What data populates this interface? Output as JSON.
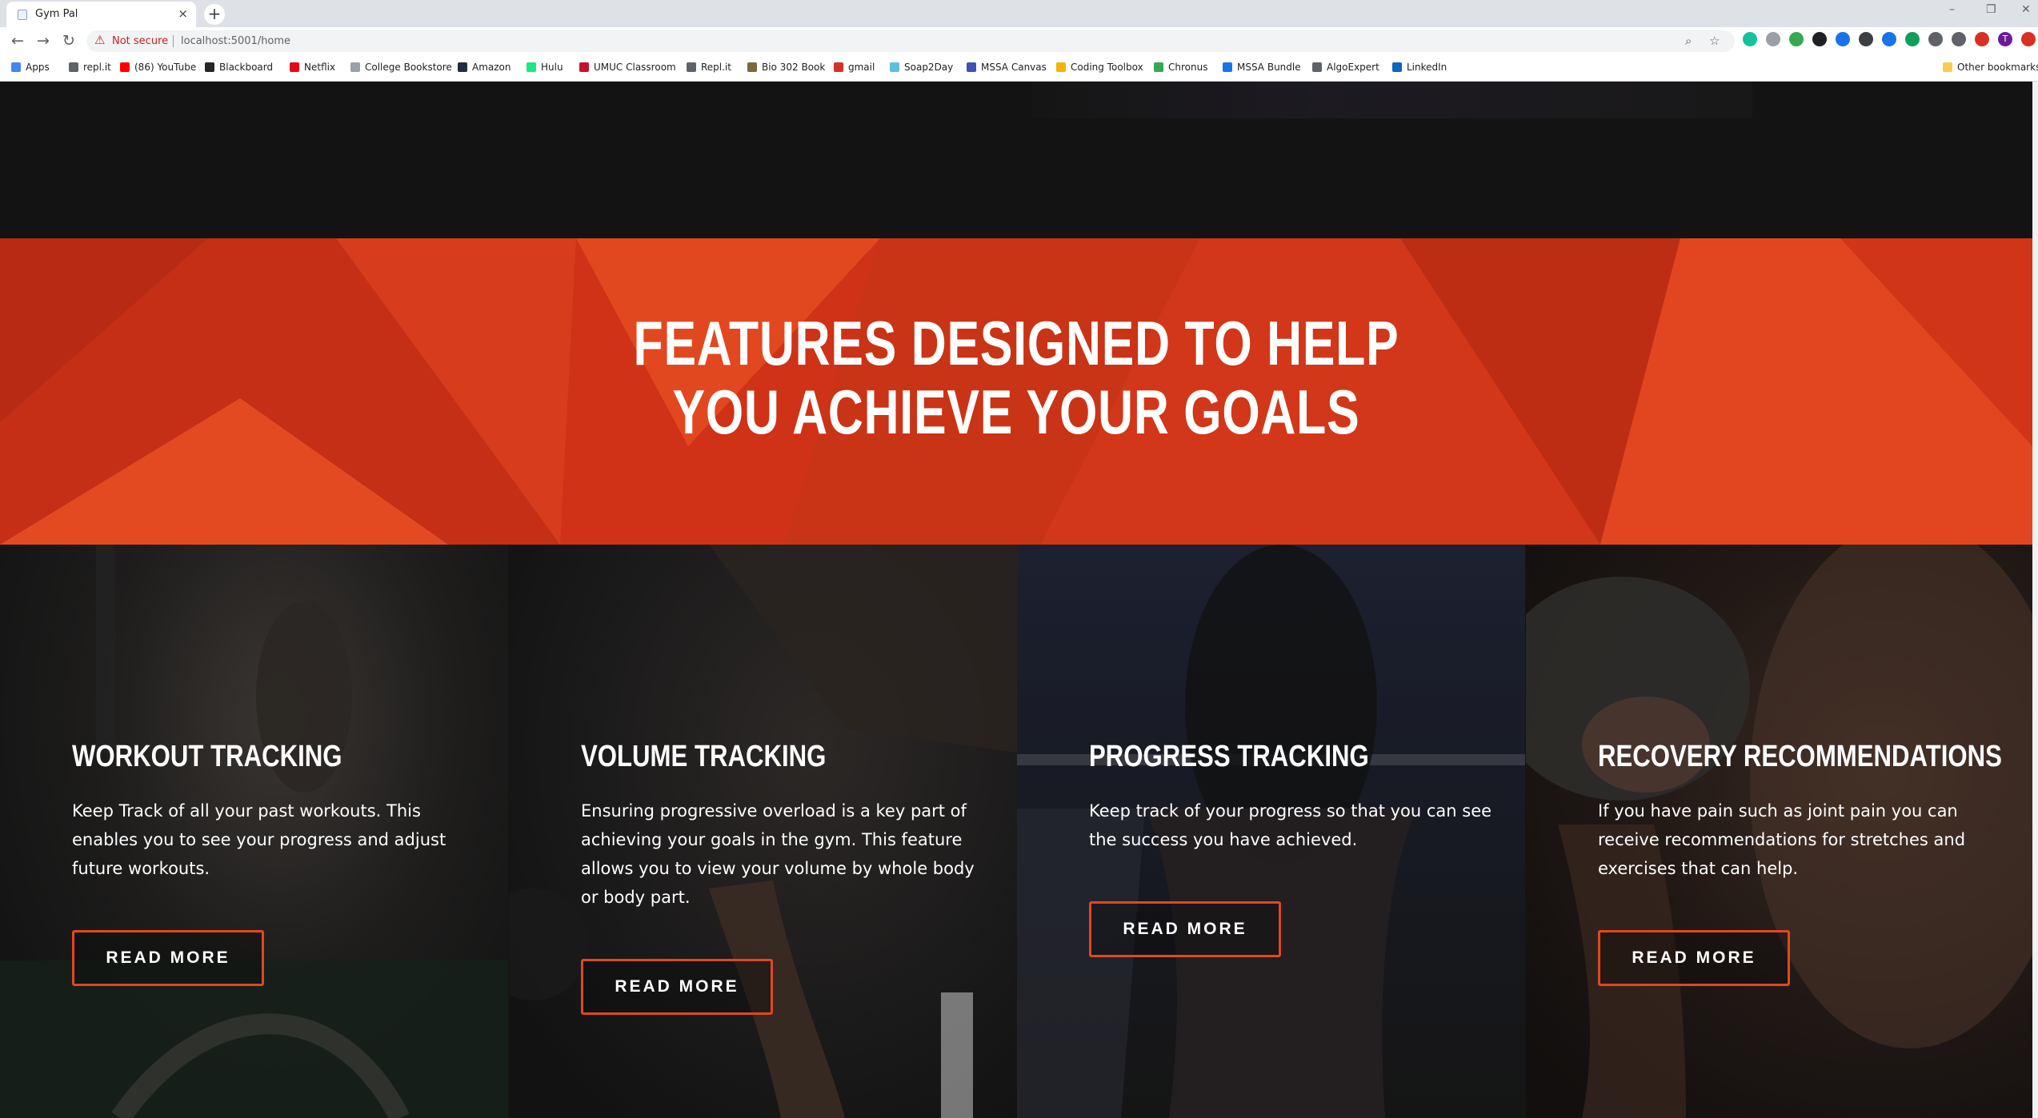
{
  "browser": {
    "tab_title": "Gym Pal",
    "tab_close": "×",
    "new_tab": "+",
    "back": "←",
    "forward": "→",
    "reload": "↻",
    "security_icon": "⚠",
    "security_label": "Not secure",
    "url": "localhost:5001/home",
    "minimize": "–",
    "restore": "❐",
    "close": "✕",
    "bookmarks": [
      {
        "label": "Apps",
        "icon_color": "#4285f4"
      },
      {
        "label": "repl.it",
        "icon_color": "#5f6368"
      },
      {
        "label": "(86) YouTube",
        "icon_color": "#ff0000"
      },
      {
        "label": "Blackboard",
        "icon_color": "#262626"
      },
      {
        "label": "Netflix",
        "icon_color": "#e50914"
      },
      {
        "label": "College Bookstore",
        "icon_color": "#9aa0a6"
      },
      {
        "label": "Amazon",
        "icon_color": "#232f3e"
      },
      {
        "label": "Hulu",
        "icon_color": "#1ce783"
      },
      {
        "label": "UMUC Classroom",
        "icon_color": "#c8102e"
      },
      {
        "label": "Repl.it",
        "icon_color": "#5f6368"
      },
      {
        "label": "Bio 302 Book",
        "icon_color": "#7a6a3a"
      },
      {
        "label": "gmail",
        "icon_color": "#d93025"
      },
      {
        "label": "Soap2Day",
        "icon_color": "#5bc0de"
      },
      {
        "label": "MSSA Canvas",
        "icon_color": "#3f51b5"
      },
      {
        "label": "Coding Toolbox",
        "icon_color": "#f4b400"
      },
      {
        "label": "Chronus",
        "icon_color": "#34a853"
      },
      {
        "label": "MSSA Bundle",
        "icon_color": "#1a73e8"
      },
      {
        "label": "AlgoExpert",
        "icon_color": "#5f6368"
      },
      {
        "label": "LinkedIn",
        "icon_color": "#0a66c2"
      },
      {
        "label": "Other bookmarks",
        "icon_color": "#f9cc4d"
      }
    ],
    "extensions": [
      {
        "icon": "search-zoom-icon",
        "color": "#5f6368"
      },
      {
        "icon": "star-icon",
        "color": "#5f6368"
      },
      {
        "icon": "grammarly-icon",
        "color": "#15c39a"
      },
      {
        "icon": "extension-gray-icon",
        "color": "#9aa0a6"
      },
      {
        "icon": "extension-green-icon",
        "color": "#34a853"
      },
      {
        "icon": "extension-dark-icon",
        "color": "#202124"
      },
      {
        "icon": "play-icon",
        "color": "#1a73e8"
      },
      {
        "icon": "extension-chat-icon",
        "color": "#3c4043"
      },
      {
        "icon": "account-icon",
        "color": "#1a73e8"
      },
      {
        "icon": "extension-circle-icon",
        "color": "#0f9d58"
      },
      {
        "icon": "puzzle-icon",
        "color": "#5f6368"
      },
      {
        "icon": "playlist-icon",
        "color": "#5f6368"
      },
      {
        "icon": "flag-icon",
        "color": "#d93025"
      },
      {
        "icon": "profile-icon",
        "color": "#6a1b9a"
      },
      {
        "icon": "update-icon",
        "color": "#d93025"
      }
    ],
    "profile_initial": "T"
  },
  "hero": {
    "line1": "FEATURES DESIGNED TO HELP",
    "line2": "YOU ACHIEVE YOUR GOALS",
    "accent_color": "#d4381a"
  },
  "features": [
    {
      "title": "WORKOUT TRACKING",
      "text": "Keep Track of all your past workouts. This enables you to see your progress and adjust future workouts.",
      "button": "READ MORE"
    },
    {
      "title": "VOLUME TRACKING",
      "text": "Ensuring progressive overload is a key part of achieving your goals in the gym. This feature allows you to view your volume by whole body or body part.",
      "button": "READ MORE"
    },
    {
      "title": "PROGRESS TRACKING",
      "text": "Keep track of your progress so that you can see the success you have achieved.",
      "button": "READ MORE"
    },
    {
      "title": "RECOVERY RECOMMENDATIONS",
      "text": "If you have pain such as joint pain you can receive recommendations for stretches and exercises that can help.",
      "button": "READ MORE"
    }
  ]
}
